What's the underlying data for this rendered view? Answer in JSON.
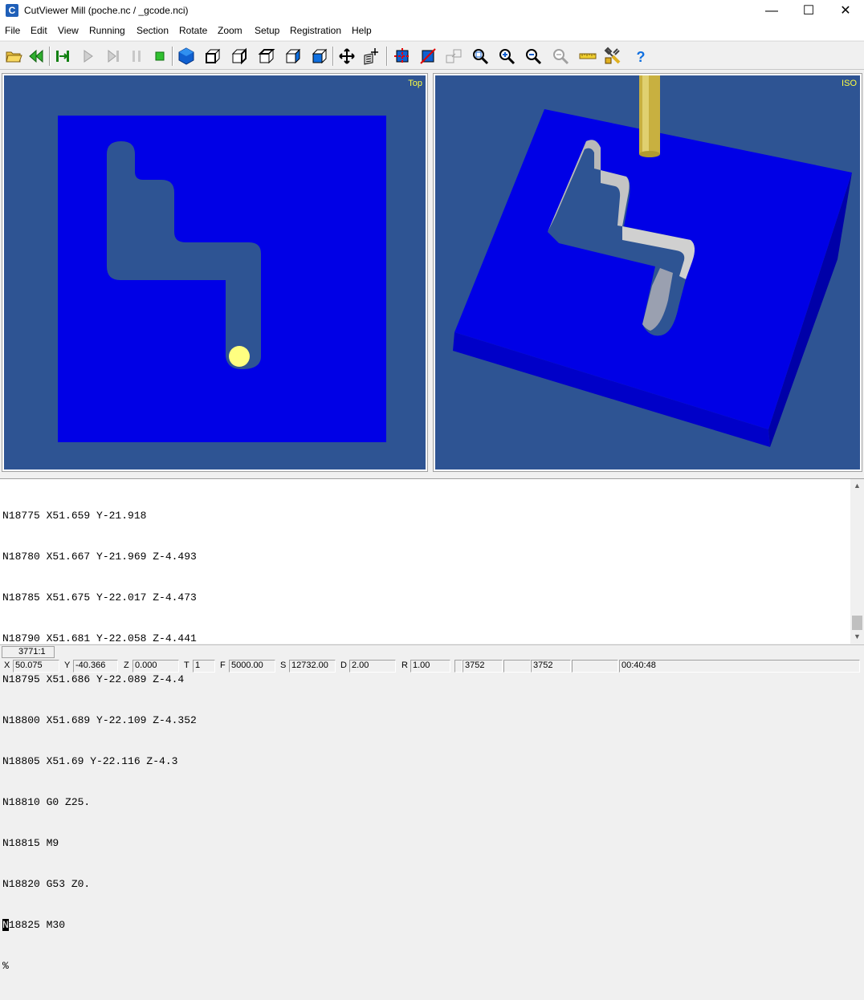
{
  "window": {
    "title": "CutViewer Mill (poche.nc / _gcode.nci)",
    "icon_letter": "C",
    "minimize_glyph": "—",
    "maximize_glyph": "☐",
    "close_glyph": "✕"
  },
  "menu": [
    "File",
    "Edit",
    "View",
    "Running",
    "Section",
    "Rotate",
    "Zoom",
    "Setup",
    "Registration",
    "Help"
  ],
  "toolbar_icons": [
    "open-folder-icon",
    "rewind-icon",
    "step-start-icon",
    "play-icon",
    "step-end-icon",
    "pause-icon",
    "stop-icon",
    "view-3d-icon",
    "view-front-icon",
    "view-right-icon",
    "view-top-icon",
    "view-left-icon",
    "view-back-icon",
    "pan-icon",
    "rotate-icon",
    "section-icon",
    "section-off-icon",
    "copy-view-icon",
    "zoom-window-icon",
    "zoom-in-icon",
    "zoom-out-icon",
    "zoom-all-icon",
    "measure-ruler-icon",
    "tools-icon",
    "help-icon"
  ],
  "views": {
    "left_label": "Top",
    "right_label": "ISO"
  },
  "colors": {
    "viewport_bg": "#2e5493",
    "stock": "#0000e6",
    "tool": "#ffff80",
    "label": "#ffff40"
  },
  "code": {
    "lines": [
      "N18775 X51.659 Y-21.918",
      "N18780 X51.667 Y-21.969 Z-4.493",
      "N18785 X51.675 Y-22.017 Z-4.473",
      "N18790 X51.681 Y-22.058 Z-4.441",
      "N18795 X51.686 Y-22.089 Z-4.4",
      "N18800 X51.689 Y-22.109 Z-4.352",
      "N18805 X51.69 Y-22.116 Z-4.3",
      "N18810 G0 Z25.",
      "N18815 M9",
      "N18820 G53 Z0."
    ],
    "current_line_prefix": "N",
    "current_line_rest": "18825 M30",
    "end_line": "%"
  },
  "line_indicator": "3771:1",
  "status": {
    "x_label": "X",
    "x_value": "50.075",
    "y_label": "Y",
    "y_value": "-40.366",
    "z_label": "Z",
    "z_value": "0.000",
    "t_label": "T",
    "t_value": "1",
    "f_label": "F",
    "f_value": "5000.00",
    "s_label": "S",
    "s_value": "12732.00",
    "d_label": "D",
    "d_value": "2.00",
    "r_label": "R",
    "r_value": "1.00",
    "count1": "3752",
    "count2": "3752",
    "time": "00:40:48"
  }
}
